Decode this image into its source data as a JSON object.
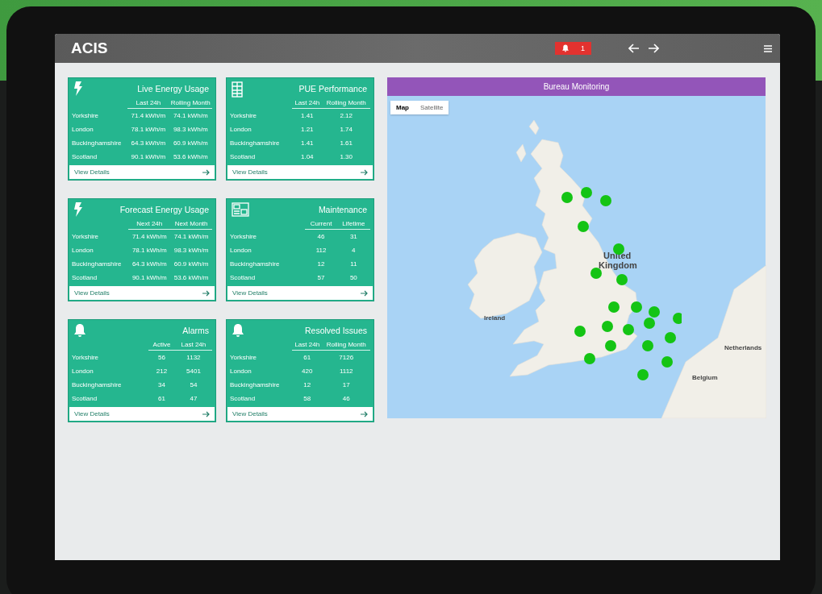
{
  "app": {
    "title": "ACIS"
  },
  "header": {
    "alert_count": "1"
  },
  "cards": [
    {
      "kind": "bolt",
      "title": "Live Energy Usage",
      "columns": [
        "Last 24h",
        "Rolling Month"
      ],
      "rows": [
        {
          "name": "Yorkshire",
          "values": [
            "71.4 kWh/m",
            "74.1 kWh/m"
          ]
        },
        {
          "name": "London",
          "values": [
            "78.1 kWh/m",
            "98.3 kWh/m"
          ]
        },
        {
          "name": "Buckinghamshire",
          "values": [
            "64.3 kWh/m",
            "60.9 kWh/m"
          ]
        },
        {
          "name": "Scotland",
          "values": [
            "90.1 kWh/m",
            "53.6 kWh/m"
          ]
        }
      ],
      "link": "View Details"
    },
    {
      "kind": "building",
      "title": "PUE Performance",
      "columns": [
        "Last 24h",
        "Rolling Month"
      ],
      "rows": [
        {
          "name": "Yorkshire",
          "values": [
            "1.41",
            "2.12"
          ]
        },
        {
          "name": "London",
          "values": [
            "1.21",
            "1.74"
          ]
        },
        {
          "name": "Buckinghamshire",
          "values": [
            "1.41",
            "1.61"
          ]
        },
        {
          "name": "Scotland",
          "values": [
            "1.04",
            "1.30"
          ]
        }
      ],
      "link": "View Details"
    },
    {
      "kind": "bolt",
      "title": "Forecast Energy Usage",
      "columns": [
        "Next 24h",
        "Next Month"
      ],
      "rows": [
        {
          "name": "Yorkshire",
          "values": [
            "71.4 kWh/m",
            "74.1 kWh/m"
          ]
        },
        {
          "name": "London",
          "values": [
            "78.1 kWh/m",
            "98.3 kWh/m"
          ]
        },
        {
          "name": "Buckinghamshire",
          "values": [
            "64.3 kWh/m",
            "60.9 kWh/m"
          ]
        },
        {
          "name": "Scotland",
          "values": [
            "90.1 kWh/m",
            "53.6 kWh/m"
          ]
        }
      ],
      "link": "View Details"
    },
    {
      "kind": "panel",
      "title": "Maintenance",
      "columns": [
        "Current",
        "Lifetime"
      ],
      "rows": [
        {
          "name": "Yorkshire",
          "values": [
            "46",
            "31"
          ]
        },
        {
          "name": "London",
          "values": [
            "112",
            "4"
          ]
        },
        {
          "name": "Buckinghamshire",
          "values": [
            "12",
            "11"
          ]
        },
        {
          "name": "Scotland",
          "values": [
            "57",
            "50"
          ]
        }
      ],
      "link": "View Details"
    },
    {
      "kind": "bell",
      "title": "Alarms",
      "columns": [
        "Active",
        "Last 24h"
      ],
      "rows": [
        {
          "name": "Yorkshire",
          "values": [
            "56",
            "1132"
          ]
        },
        {
          "name": "London",
          "values": [
            "212",
            "5401"
          ]
        },
        {
          "name": "Buckinghamshire",
          "values": [
            "34",
            "54"
          ]
        },
        {
          "name": "Scotland",
          "values": [
            "61",
            "47"
          ]
        }
      ],
      "link": "View Details"
    },
    {
      "kind": "bell",
      "title": "Resolved Issues",
      "columns": [
        "Last 24h",
        "Rolling Month"
      ],
      "rows": [
        {
          "name": "Yorkshire",
          "values": [
            "61",
            "7126"
          ]
        },
        {
          "name": "London",
          "values": [
            "420",
            "1112"
          ]
        },
        {
          "name": "Buckinghamshire",
          "values": [
            "12",
            "17"
          ]
        },
        {
          "name": "Scotland",
          "values": [
            "58",
            "46"
          ]
        }
      ],
      "link": "View Details"
    }
  ],
  "map": {
    "title": "Bureau Monitoring",
    "map_types": [
      {
        "label": "Map",
        "selected": true
      },
      {
        "label": "Satellite",
        "selected": false
      }
    ],
    "labels": [
      {
        "text": "United",
        "kind": "country"
      },
      {
        "text": "Kingdom",
        "kind": "country"
      },
      {
        "text": "Ireland",
        "kind": "country"
      },
      {
        "text": "Netherlands",
        "kind": "country"
      },
      {
        "text": "Belgium",
        "kind": "country"
      }
    ]
  }
}
